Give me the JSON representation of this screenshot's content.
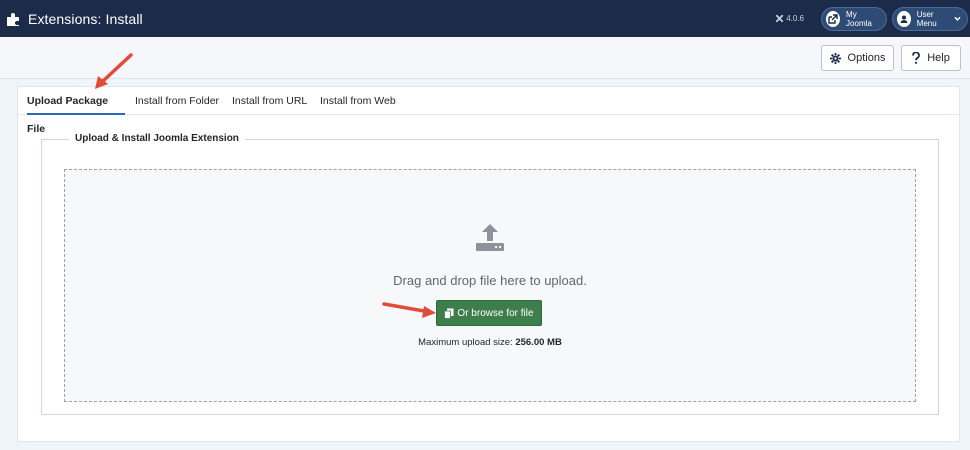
{
  "header": {
    "title": "Extensions: Install",
    "version": "4.0.6",
    "my_joomla": "My Joomla",
    "user_menu": "User Menu"
  },
  "toolbar": {
    "options_label": "Options",
    "help_label": "Help"
  },
  "tabs": [
    {
      "label": "Upload Package File",
      "active": true
    },
    {
      "label": "Install from Folder",
      "active": false
    },
    {
      "label": "Install from URL",
      "active": false
    },
    {
      "label": "Install from Web",
      "active": false
    }
  ],
  "install": {
    "legend": "Upload & Install Joomla Extension",
    "drop_message": "Drag and drop file here to upload.",
    "browse_label": "Or browse for file",
    "max_size_label": "Maximum upload size:",
    "max_size_value": "256.00 MB"
  },
  "colors": {
    "header_bg": "#1c2b4a",
    "active_tab_accent": "#2a69b8",
    "browse_button": "#3d7e4a",
    "annotation_arrow": "#e24b3a"
  },
  "icons": {
    "header": "puzzle-icon",
    "version": "joomla-icon",
    "my_joomla": "external-link-icon",
    "user_menu": "user-circle-icon",
    "options": "gear-icon",
    "help": "question-icon",
    "upload": "upload-icon",
    "browse": "copy-icon"
  }
}
